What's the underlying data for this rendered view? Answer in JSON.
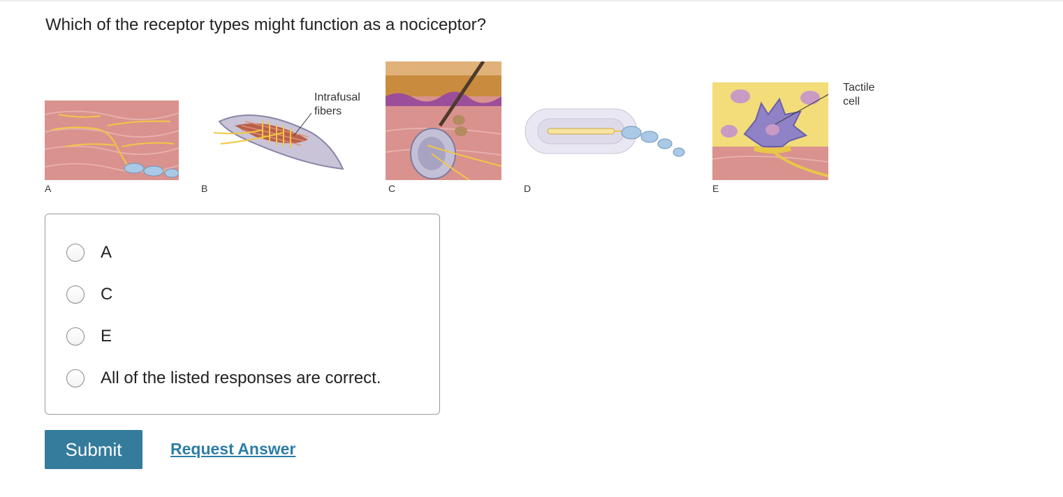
{
  "question": {
    "text": "Which of the receptor types might function as a nociceptor?"
  },
  "figure": {
    "panel_labels": [
      "A",
      "B",
      "C",
      "D",
      "E"
    ],
    "callouts": {
      "b_line1": "Intrafusal",
      "b_line2": "fibers",
      "e_line1": "Tactile",
      "e_line2": "cell"
    }
  },
  "choices": [
    {
      "label": "A",
      "selected": false
    },
    {
      "label": "C",
      "selected": false
    },
    {
      "label": "E",
      "selected": false
    },
    {
      "label": "All of the listed responses are correct.",
      "selected": false
    }
  ],
  "actions": {
    "submit_label": "Submit",
    "request_label": "Request Answer"
  },
  "colors": {
    "submit_bg": "#347b9c",
    "link": "#2c7ea4"
  }
}
